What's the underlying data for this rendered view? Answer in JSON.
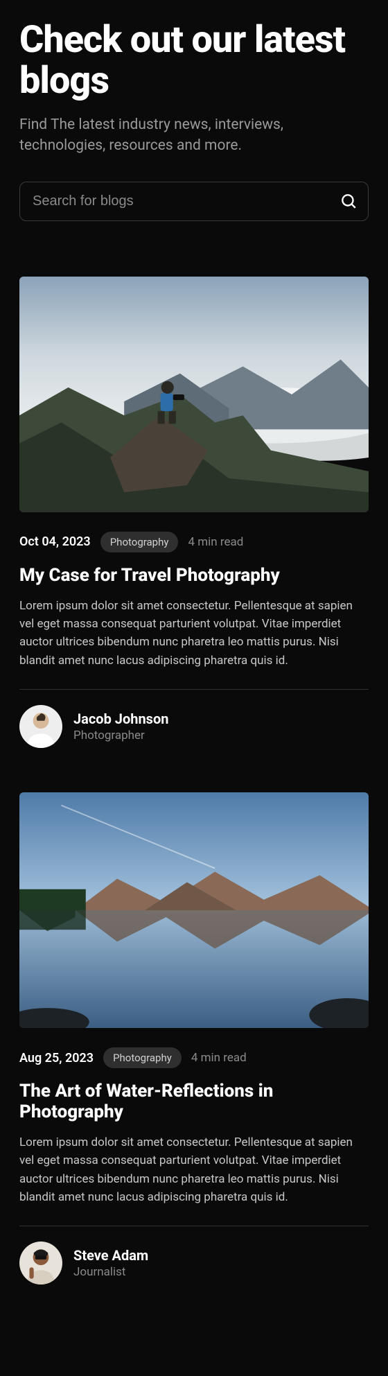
{
  "header": {
    "title": "Check out our latest blogs",
    "subtitle": "Find The latest industry news, interviews, technologies, resources and more."
  },
  "search": {
    "placeholder": "Search for blogs"
  },
  "posts": [
    {
      "date": "Oct 04, 2023",
      "tag": "Photography",
      "read": "4 min read",
      "title": "My Case for Travel Photography",
      "excerpt": "Lorem ipsum dolor sit amet consectetur. Pellentesque at sapien vel eget massa consequat parturient volutpat. Vitae imperdiet auctor ultrices bibendum nunc pharetra leo mattis purus. Nisi blandit amet nunc lacus adipiscing pharetra quis id.",
      "author": {
        "name": "Jacob Johnson",
        "role": "Photographer"
      }
    },
    {
      "date": "Aug 25, 2023",
      "tag": "Photography",
      "read": "4 min read",
      "title": "The Art of Water-Reflections in Photography",
      "excerpt": "Lorem ipsum dolor sit amet consectetur. Pellentesque at sapien vel eget massa consequat parturient volutpat. Vitae imperdiet auctor ultrices bibendum nunc pharetra leo mattis purus. Nisi blandit amet nunc lacus adipiscing pharetra quis id.",
      "author": {
        "name": "Steve Adam",
        "role": "Journalist"
      }
    }
  ]
}
